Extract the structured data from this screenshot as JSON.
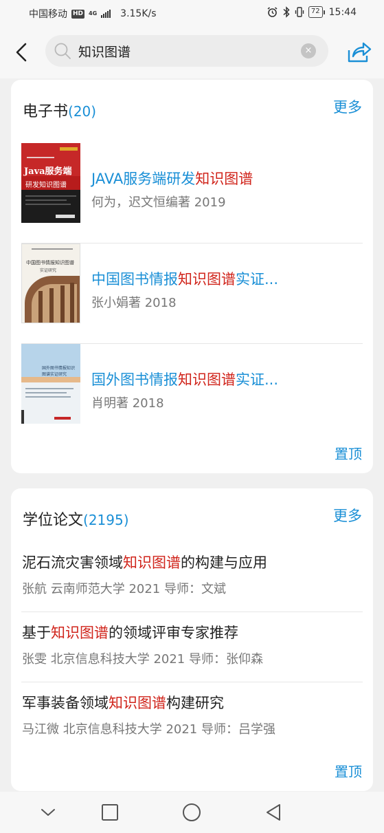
{
  "status_bar": {
    "carrier": "中国移动",
    "hd": "HD",
    "network_type": "4G",
    "speed": "3.15K/s",
    "battery": "72",
    "time": "15:44"
  },
  "search": {
    "query": "知识图谱",
    "clear_icon": "×"
  },
  "colors": {
    "accent": "#1a8fd6",
    "highlight": "#d0241b"
  },
  "icons": {
    "back": "chevron-left-icon",
    "search": "search-icon",
    "clear": "clear-icon",
    "share": "share-icon",
    "nav_down": "chevron-down-icon",
    "nav_recent": "square-icon",
    "nav_home": "circle-icon",
    "nav_back": "triangle-back-icon"
  },
  "ebooks": {
    "title": "电子书",
    "count": "(20)",
    "more": "更多",
    "pin": "置顶",
    "items": [
      {
        "title_pre": "JAVA服务端研发",
        "title_hl": "知识图谱",
        "title_post": "",
        "meta": "何为，迟文恒编著   2019",
        "cover_line1": "Java服务端",
        "cover_line2": "研发知识图谱"
      },
      {
        "title_pre": "中国图书情报",
        "title_hl": "知识图谱",
        "title_post": "实证...",
        "meta": "张小娟著   2018",
        "cover_line1": "中国图书情报知识图谱",
        "cover_line2": "实证研究"
      },
      {
        "title_pre": "国外图书情报",
        "title_hl": "知识图谱",
        "title_post": "实证...",
        "meta": "肖明著   2018",
        "cover_line1": "国外图书情报知识",
        "cover_line2": "图谱实证研究"
      }
    ]
  },
  "theses": {
    "title": "学位论文",
    "count": "(2195)",
    "more": "更多",
    "pin": "置顶",
    "items": [
      {
        "title_pre": "泥石流灾害领域",
        "title_hl": "知识图谱",
        "title_post": "的构建与应用",
        "meta": "张航 云南师范大学 2021  导师：文斌"
      },
      {
        "title_pre": "基于",
        "title_hl": "知识图谱",
        "title_post": "的领域评审专家推荐",
        "meta": "张雯 北京信息科技大学 2021  导师：张仰森"
      },
      {
        "title_pre": "军事装备领域",
        "title_hl": "知识图谱",
        "title_post": "构建研究",
        "meta": "马江微 北京信息科技大学 2021  导师：吕学强"
      }
    ]
  }
}
